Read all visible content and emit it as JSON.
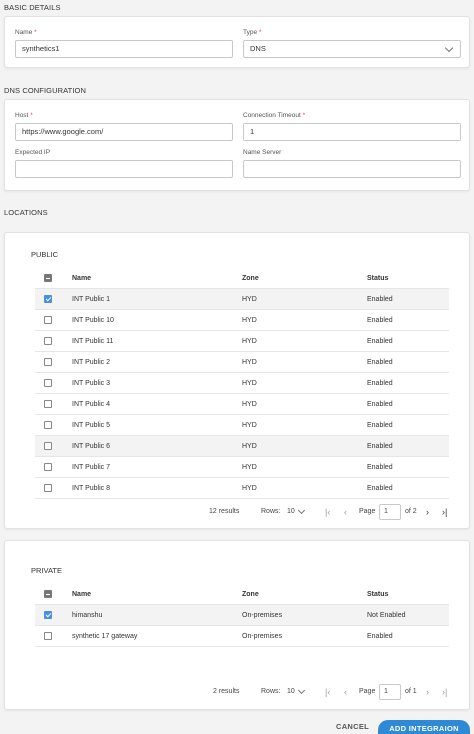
{
  "basic_details": {
    "title": "BASIC DETAILS",
    "name_label": "Name",
    "name_value": "synthetics1",
    "type_label": "Type",
    "type_value": "DNS",
    "required_mark": "*"
  },
  "dns_config": {
    "title": "DNS CONFIGURATION",
    "host_label": "Host",
    "host_value": "https://www.google.com/",
    "timeout_label": "Connection Timeout",
    "timeout_value": "1",
    "expected_ip_label": "Expected IP",
    "expected_ip_value": "",
    "name_server_label": "Name Server",
    "name_server_value": ""
  },
  "locations": {
    "title": "LOCATIONS",
    "columns": [
      "Name",
      "Zone",
      "Status"
    ],
    "public": {
      "title": "PUBLIC",
      "rows": [
        {
          "name": "INT Public 1",
          "zone": "HYD",
          "status": "Enabled",
          "checked": true
        },
        {
          "name": "INT Public 10",
          "zone": "HYD",
          "status": "Enabled",
          "checked": false
        },
        {
          "name": "INT Public 11",
          "zone": "HYD",
          "status": "Enabled",
          "checked": false
        },
        {
          "name": "INT Public 2",
          "zone": "HYD",
          "status": "Enabled",
          "checked": false
        },
        {
          "name": "INT Public 3",
          "zone": "HYD",
          "status": "Enabled",
          "checked": false
        },
        {
          "name": "INT Public 4",
          "zone": "HYD",
          "status": "Enabled",
          "checked": false
        },
        {
          "name": "INT Public 5",
          "zone": "HYD",
          "status": "Enabled",
          "checked": false
        },
        {
          "name": "INT Public 6",
          "zone": "HYD",
          "status": "Enabled",
          "checked": false
        },
        {
          "name": "INT Public 7",
          "zone": "HYD",
          "status": "Enabled",
          "checked": false
        },
        {
          "name": "INT Public 8",
          "zone": "HYD",
          "status": "Enabled",
          "checked": false
        }
      ],
      "pager": {
        "results": "12 results",
        "rows_label": "Rows:",
        "rows_value": "10",
        "page_label": "Page",
        "page_value": "1",
        "of_label": "of 2"
      }
    },
    "private": {
      "title": "PRIVATE",
      "rows": [
        {
          "name": "himanshu",
          "zone": "On-premises",
          "status": "Not Enabled",
          "checked": true
        },
        {
          "name": "synthetic 17 gateway",
          "zone": "On-premises",
          "status": "Enabled",
          "checked": false
        }
      ],
      "pager": {
        "results": "2 results",
        "rows_label": "Rows:",
        "rows_value": "10",
        "page_label": "Page",
        "page_value": "1",
        "of_label": "of 1"
      }
    }
  },
  "footer": {
    "cancel_label": "CANCEL",
    "add_label": "ADD INTEGRAION"
  },
  "colors": {
    "accent": "#2f8ad6",
    "checkbox_checked": "#4a90e2",
    "required": "#e04848"
  }
}
